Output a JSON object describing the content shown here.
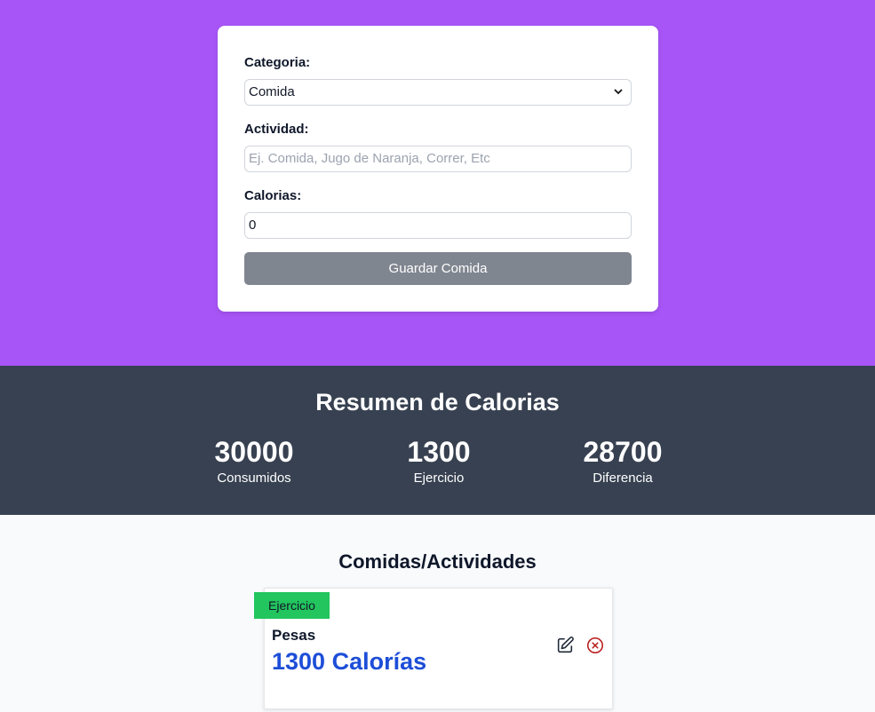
{
  "form": {
    "category_label": "Categoria:",
    "category_value": "Comida",
    "activity_label": "Actividad:",
    "activity_placeholder": "Ej. Comida, Jugo de Naranja, Correr, Etc",
    "calories_label": "Calorias:",
    "calories_value": "0",
    "submit_label": "Guardar Comida"
  },
  "summary": {
    "title": "Resumen de Calorias",
    "stats": [
      {
        "value": "30000",
        "label": "Consumidos"
      },
      {
        "value": "1300",
        "label": "Ejercicio"
      },
      {
        "value": "28700",
        "label": "Diferencia"
      }
    ]
  },
  "activities": {
    "title": "Comidas/Actividades",
    "items": [
      {
        "category": "Ejercicio",
        "name": "Pesas",
        "calories": "1300 Calorías",
        "edit_icon": "edit-icon",
        "delete_icon": "x-circle-icon"
      }
    ]
  },
  "colors": {
    "hero_bg": "#a855f7",
    "summary_bg": "#374151",
    "badge_green": "#22c55e",
    "calories_blue": "#1d4ed8",
    "delete_red": "#b91c1c"
  }
}
